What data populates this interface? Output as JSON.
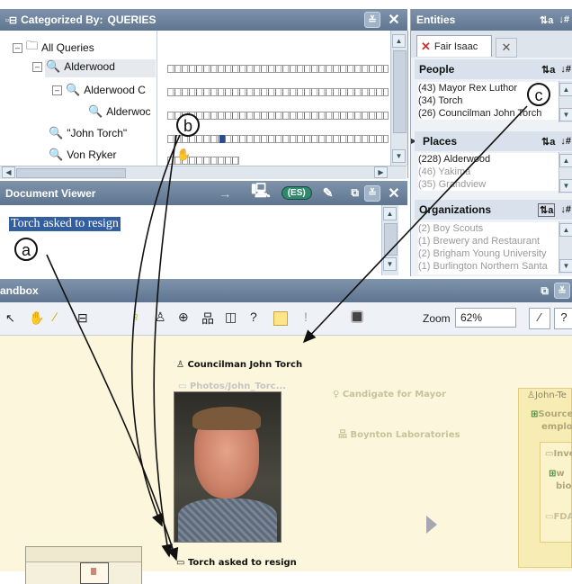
{
  "categorized": {
    "title_prefix": "Categorized By:",
    "title_value": "QUERIES",
    "tree": [
      {
        "label": "All Queries",
        "expander": "⊟"
      },
      {
        "label": "Alderwood",
        "expander": "⊟"
      },
      {
        "label": "Alderwood C",
        "expander": "⊟"
      },
      {
        "label": "Alderwoc",
        "expander": ""
      },
      {
        "label": "\"John Torch\"",
        "expander": ""
      },
      {
        "label": "Von Ryker",
        "expander": ""
      }
    ]
  },
  "entities": {
    "title": "Entities",
    "tab_label": "Fair Isaac",
    "people": {
      "heading": "People",
      "items": [
        "(43) Mayor Rex Luthor",
        "(34) Torch",
        "(26) Councilman John Torch"
      ]
    },
    "places": {
      "heading": "Places",
      "items": [
        "(228) Alderwood",
        "(46) Yakima",
        "(35) Grandview"
      ]
    },
    "organizations": {
      "heading": "Organizations",
      "items": [
        "(2) Boy Scouts",
        "(1) Brewery and Restaurant",
        "(2) Brigham Young University",
        "(1) Burlington Northern Santa"
      ]
    }
  },
  "document_viewer": {
    "title": "Document Viewer",
    "selected_text": "Torch asked to resign",
    "search_button": "(ES)"
  },
  "sandbox": {
    "title": "andbox",
    "zoom_label": "Zoom",
    "zoom_value": "62%",
    "nodes": {
      "councilman": "Councilman John Torch",
      "photo_caption": "Photos/John_Torc...",
      "candidate": "Candigate for Mayor",
      "boynton": "Boynton Laboratories",
      "resign": "Torch asked to resign",
      "john_t": "John-Te",
      "source": "Source",
      "employ": "emplo",
      "inve": "Inve",
      "w": "w",
      "bio": "bio",
      "fda": "FDA"
    }
  },
  "callouts": {
    "a": "a",
    "b": "b",
    "c": "c"
  }
}
